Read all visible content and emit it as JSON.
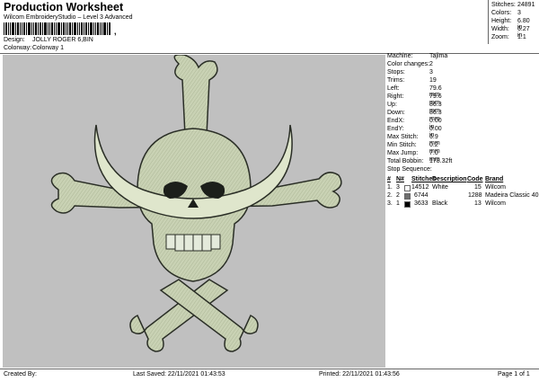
{
  "header": {
    "title": "Production Worksheet",
    "subtitle": "Wilcom EmbroideryStudio – Level 3 Advanced",
    "barcode_suffix": ",",
    "design_label": "Design:",
    "design_value": "JOLLY ROGER 6,BIN",
    "colorway_label": "Colorway:",
    "colorway_value": "Colorway 1"
  },
  "stats": [
    {
      "label": "Stitches:",
      "value": "24891"
    },
    {
      "label": "Colors:",
      "value": "3"
    },
    {
      "label": "Height:",
      "value": "6.80 in"
    },
    {
      "label": "Width:",
      "value": "6.27 in"
    },
    {
      "label": "Zoom:",
      "value": "1:1"
    }
  ],
  "properties": [
    {
      "label": "Machine:",
      "value": "Tajima"
    },
    {
      "label": "Color changes:",
      "value": "2"
    },
    {
      "label": "Stops:",
      "value": "3"
    },
    {
      "label": "Trims:",
      "value": "19"
    },
    {
      "label": "Left:",
      "value": "79.6 mm"
    },
    {
      "label": "Right:",
      "value": "79.6 mm"
    },
    {
      "label": "Up:",
      "value": "86.3 mm"
    },
    {
      "label": "Down:",
      "value": "86.3 mm"
    },
    {
      "label": "EndX:",
      "value": "0.00 in"
    },
    {
      "label": "EndY:",
      "value": "0.00 in"
    },
    {
      "label": "Max Stitch:",
      "value": "6.9 mm"
    },
    {
      "label": "Min Stitch:",
      "value": "0.2 mm"
    },
    {
      "label": "Max Jump:",
      "value": "7.0 mm"
    },
    {
      "label": "Total Bobbin:",
      "value": "178.32ft"
    }
  ],
  "stop_sequence": {
    "title": "Stop Sequence:",
    "headers": {
      "num": "#",
      "n": "N#",
      "stitches": "Stitches",
      "description": "Description",
      "code": "Code",
      "brand": "Brand"
    },
    "rows": [
      {
        "num": "1.",
        "n": "3",
        "stitches": "14512",
        "description": "White",
        "code": "15",
        "brand": "Wilcom",
        "color": "#ffffff"
      },
      {
        "num": "2.",
        "n": "2",
        "stitches": "6744",
        "description": "",
        "code": "1288",
        "brand": "Madeira Classic 40",
        "color": "#6e6e6e"
      },
      {
        "num": "3.",
        "n": "1",
        "stitches": "3633",
        "description": "Black",
        "code": "13",
        "brand": "Wilcom",
        "color": "#000000"
      }
    ]
  },
  "footer": {
    "created_by": "Created By:",
    "last_saved": "Last Saved: 22/11/2021 01:43:53",
    "printed": "Printed: 22/11/2021 01:43:56",
    "page": "Page 1 of 1"
  },
  "colors": {
    "design_background": "#c0c0c0",
    "bone": "#c9d2b4",
    "bone_dark": "#5c6450",
    "outline": "#2a2e26"
  }
}
